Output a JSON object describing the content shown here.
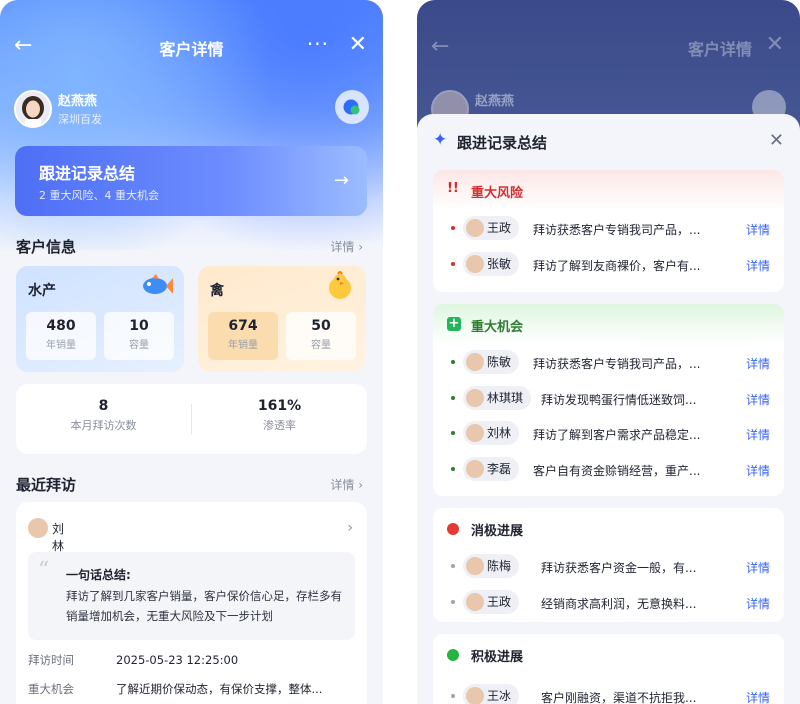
{
  "left": {
    "nav": {
      "back": "←",
      "title": "客户详情",
      "more": "···",
      "close": "✕"
    },
    "profile": {
      "name": "赵燕燕",
      "company": "深圳百发"
    },
    "summary": {
      "title": "跟进记录总结",
      "subtitle": "2 重大风险、4 重大机会",
      "arrow": "→"
    },
    "customer_info": {
      "title": "客户信息",
      "more": "详情 ›"
    },
    "categories": [
      {
        "name": "水产",
        "icon": "🐟",
        "stats": [
          {
            "value": "480",
            "label": "年销量"
          },
          {
            "value": "10",
            "label": "容量"
          }
        ]
      },
      {
        "name": "禽",
        "icon": "🐥",
        "stats": [
          {
            "value": "674",
            "label": "年销量"
          },
          {
            "value": "50",
            "label": "容量"
          }
        ]
      }
    ],
    "totals": [
      {
        "value": "8",
        "label": "本月拜访次数"
      },
      {
        "value": "161%",
        "label": "渗透率"
      }
    ],
    "recent": {
      "title": "最近拜访",
      "more": "详情 ›"
    },
    "visit": {
      "person": "刘林",
      "chevron": "›",
      "quote_mark": "“",
      "summary_title": "一句话总结:",
      "summary_body": "拜访了解到几家客户销量，客户保价信心足，存栏多有销量增加机会，无重大风险及下一步计划",
      "fields": [
        {
          "key": "拜访时间",
          "value": "2025-05-23 12:25:00"
        },
        {
          "key": "重大机会",
          "value": "了解近期价保动态，有保价支撑，整体..."
        }
      ]
    }
  },
  "right": {
    "background": {
      "back": "←",
      "title": "客户详情",
      "close": "✕",
      "name": "赵燕燕"
    },
    "sheet": {
      "icon": "✦",
      "title": "跟进记录总结",
      "close": "✕"
    },
    "groups": [
      {
        "key": "risk",
        "icon": "!!",
        "title": "重大风险",
        "items": [
          {
            "name": "王政",
            "text": "拜访获悉客户专销我司产品，...",
            "action": "详情"
          },
          {
            "name": "张敏",
            "text": "拜访了解到友商裸价，客户有...",
            "action": "详情"
          }
        ]
      },
      {
        "key": "opp",
        "icon": "+",
        "title": "重大机会",
        "items": [
          {
            "name": "陈敏",
            "text": "拜访获悉客户专销我司产品，...",
            "action": "详情"
          },
          {
            "name": "林琪琪",
            "text": "拜访发现鸭蛋行情低迷致饲...",
            "action": "详情"
          },
          {
            "name": "刘林",
            "text": "拜访了解到客户需求产品稳定...",
            "action": "详情"
          },
          {
            "name": "李磊",
            "text": "客户自有资金赊销经营，重产...",
            "action": "详情"
          }
        ]
      },
      {
        "key": "neg",
        "icon": "",
        "title": "消极进展",
        "items": [
          {
            "name": "陈梅",
            "text": "拜访获悉客户资金一般，有...",
            "action": "详情"
          },
          {
            "name": "王政",
            "text": "经销商求高利润，无意换料...",
            "action": "详情"
          }
        ]
      },
      {
        "key": "pos",
        "icon": "",
        "title": "积极进展",
        "items": [
          {
            "name": "王冰",
            "text": "客户刚融资，渠道不抗拒我...",
            "action": "详情"
          }
        ]
      }
    ]
  }
}
